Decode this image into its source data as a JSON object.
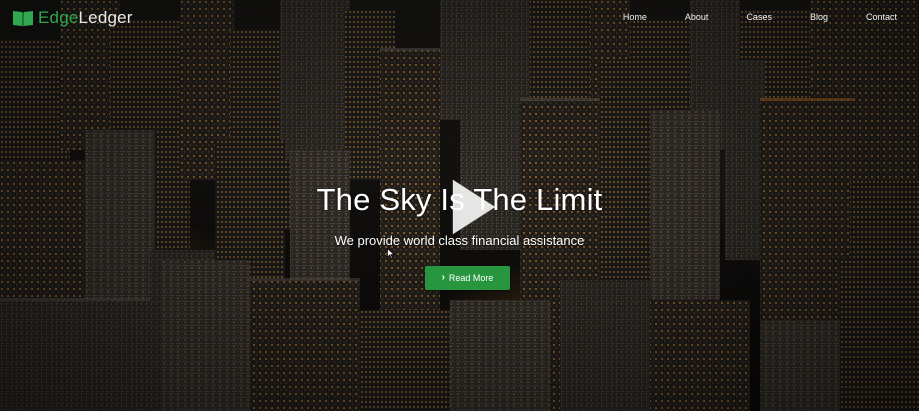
{
  "brand": {
    "name_part_1": "Edge",
    "name_part_2": "Ledger",
    "icon": "open-book-icon",
    "color_accent": "#2fa84f"
  },
  "nav": {
    "items": [
      {
        "label": "Home"
      },
      {
        "label": "About"
      },
      {
        "label": "Cases"
      },
      {
        "label": "Blog"
      },
      {
        "label": "Contact"
      }
    ]
  },
  "hero": {
    "title": "The Sky Is The Limit",
    "subtitle": "We provide world class financial assistance",
    "play_icon": "play-icon",
    "cta": {
      "label": "Read More",
      "icon": "chevron-right-icon",
      "color": "#28963f"
    },
    "background": "night-city-skyline"
  }
}
